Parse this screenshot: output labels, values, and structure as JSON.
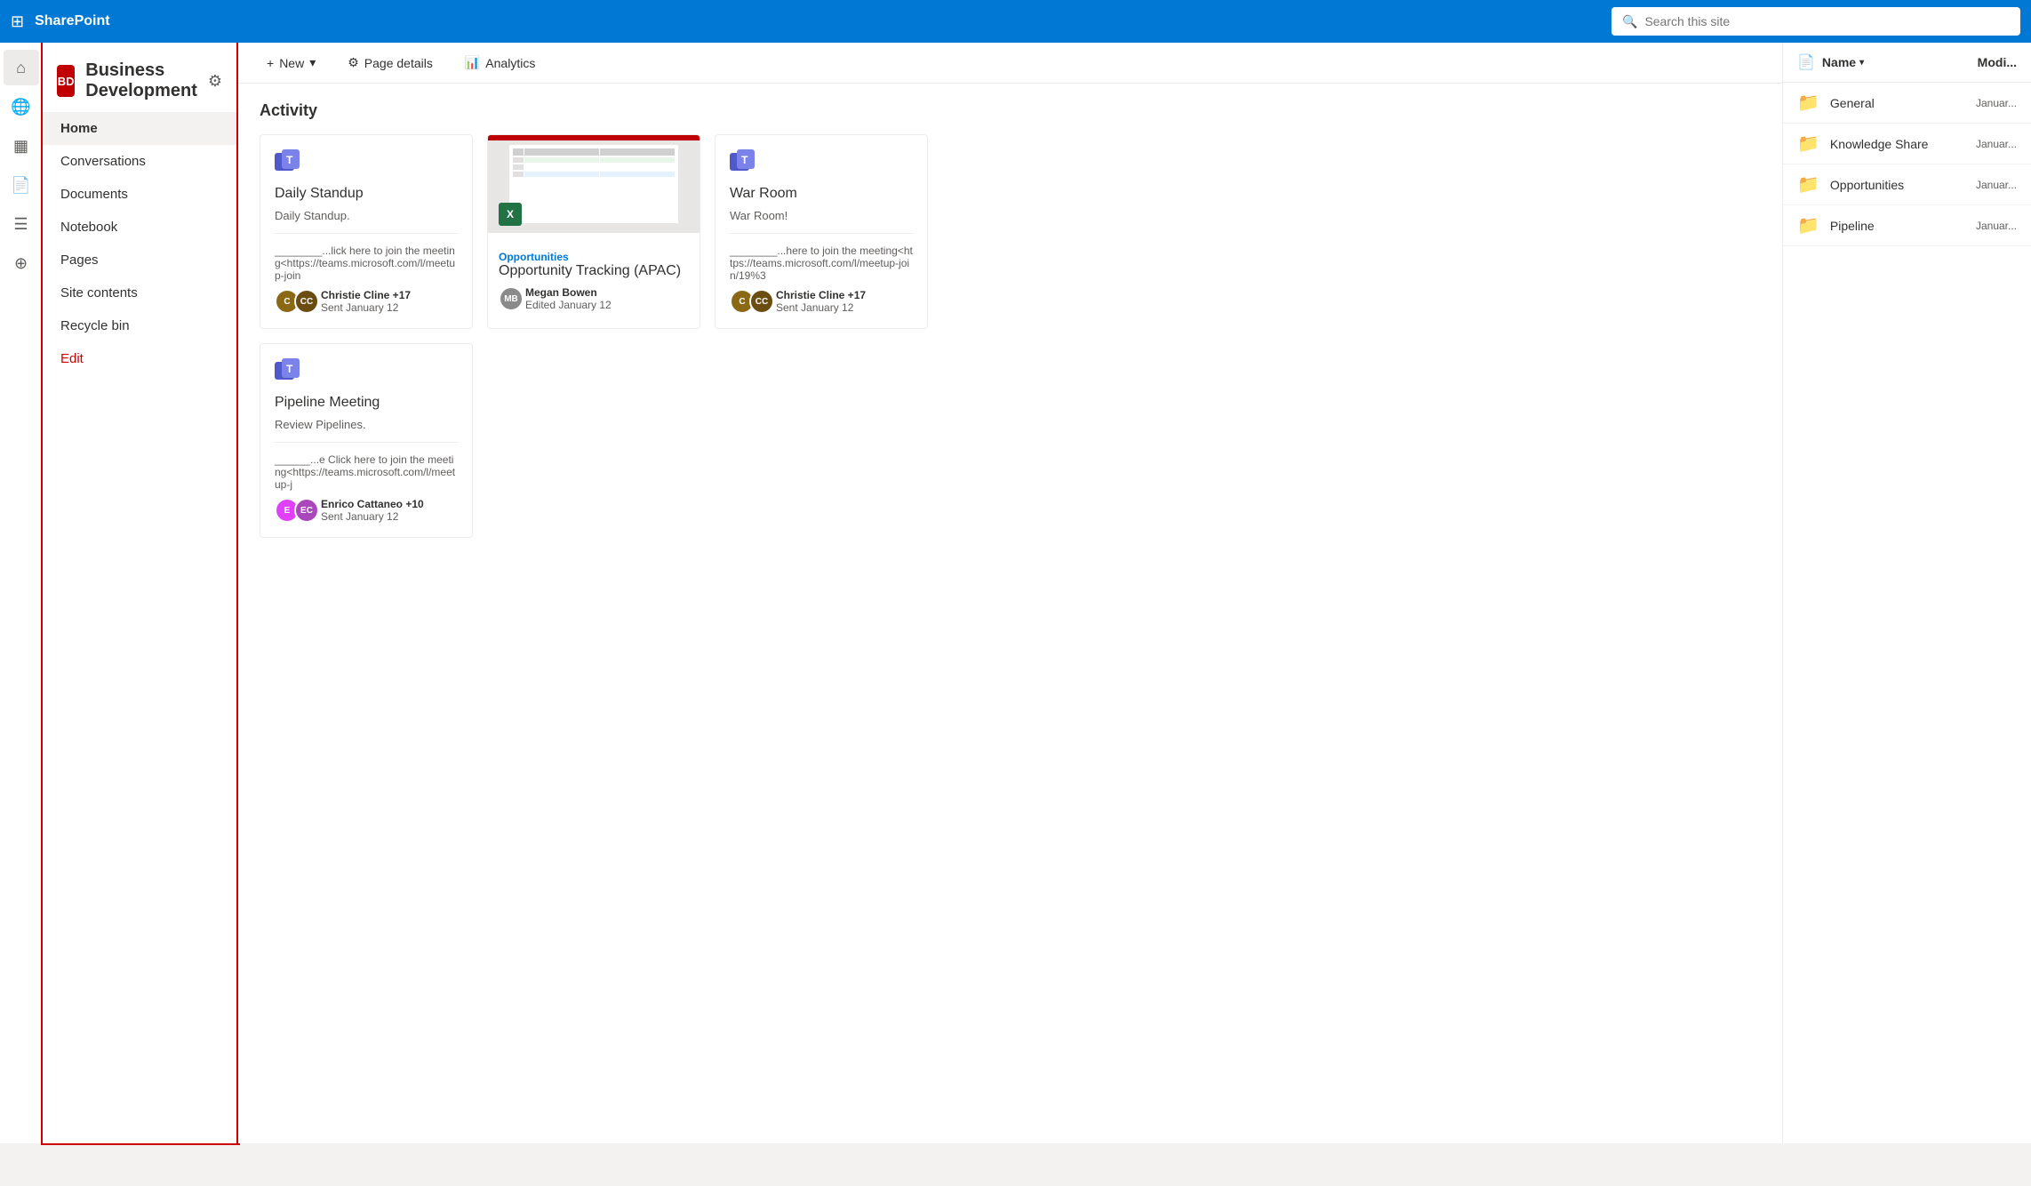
{
  "topbar": {
    "app_name": "SharePoint",
    "search_placeholder": "Search this site"
  },
  "icon_rail": {
    "items": [
      {
        "name": "home-icon",
        "icon": "⌂",
        "active": true
      },
      {
        "name": "globe-icon",
        "icon": "🌐"
      },
      {
        "name": "table-icon",
        "icon": "▦"
      },
      {
        "name": "page-icon",
        "icon": "📄"
      },
      {
        "name": "list-icon",
        "icon": "☰"
      },
      {
        "name": "plus-circle-icon",
        "icon": "⊕"
      }
    ]
  },
  "sidenav": {
    "site_badge": "BD",
    "site_title": "Business Development",
    "items": [
      {
        "label": "Home",
        "active": true
      },
      {
        "label": "Conversations",
        "active": false
      },
      {
        "label": "Documents",
        "active": false
      },
      {
        "label": "Notebook",
        "active": false
      },
      {
        "label": "Pages",
        "active": false
      },
      {
        "label": "Site contents",
        "active": false
      },
      {
        "label": "Recycle bin",
        "active": false
      },
      {
        "label": "Edit",
        "active": false,
        "is_edit": true
      }
    ]
  },
  "toolbar": {
    "new_label": "New",
    "page_details_label": "Page details",
    "analytics_label": "Analytics"
  },
  "activity": {
    "section_title": "Activity",
    "cards": [
      {
        "id": "daily-standup",
        "icon_type": "teams",
        "title": "Daily Standup",
        "description": "Daily Standup.",
        "link": "________...lick here to join the meeting<https://teams.microsoft.com/l/meetup-join",
        "avatar1_initials": "C",
        "avatar1_color": "#8b6914",
        "avatar2_initials": "CC",
        "avatar2_color": "#6b4c11",
        "author": "Christie Cline +17",
        "date": "Sent January 12"
      },
      {
        "id": "opportunities",
        "icon_type": "excel",
        "title": "Opportunity Tracking (APAC)",
        "tag": "Opportunities",
        "has_thumbnail": true,
        "avatar1_initials": "MB",
        "avatar1_color": "#8a8a8a",
        "author": "Megan Bowen",
        "date": "Edited January 12"
      },
      {
        "id": "war-room",
        "icon_type": "teams",
        "title": "War Room",
        "description": "War Room!",
        "link": "________...here to join the meeting<https://teams.microsoft.com/l/meetup-join/19%3",
        "avatar1_initials": "C",
        "avatar1_color": "#8b6914",
        "avatar2_initials": "CC",
        "avatar2_color": "#6b4c11",
        "author": "Christie Cline +17",
        "date": "Sent January 12"
      }
    ],
    "cards_row2": [
      {
        "id": "pipeline-meeting",
        "icon_type": "teams",
        "title": "Pipeline Meeting",
        "description": "Review Pipelines.",
        "link": "______...e Click here to join the meeting<https://teams.microsoft.com/l/meetup-j",
        "avatar1_initials": "E",
        "avatar1_color": "#e040fb",
        "avatar2_initials": "EC",
        "avatar2_color": "#ab47bc",
        "author": "Enrico Cattaneo +10",
        "date": "Sent January 12"
      }
    ]
  },
  "right_panel": {
    "name_label": "Name",
    "modified_label": "Modi...",
    "folders": [
      {
        "name": "General",
        "date": "Januar..."
      },
      {
        "name": "Knowledge Share",
        "date": "Januar..."
      },
      {
        "name": "Opportunities",
        "date": "Januar..."
      },
      {
        "name": "Pipeline",
        "date": "Januar..."
      }
    ]
  }
}
